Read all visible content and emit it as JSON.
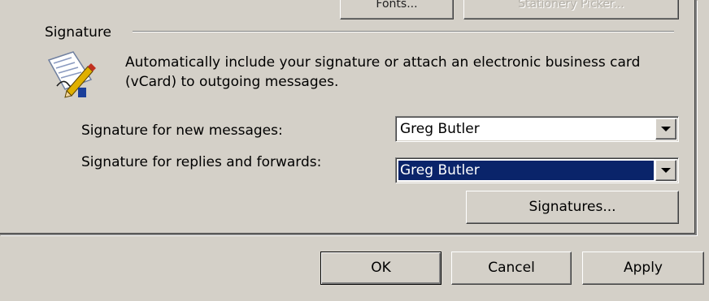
{
  "top_buttons": [
    {
      "label": "Fonts...",
      "disabled": false
    },
    {
      "label": "Stationery Picker...",
      "disabled": true
    }
  ],
  "signature_group": {
    "title": "Signature",
    "icon": "signature-pen-icon",
    "description": "Automatically include your signature or attach an electronic business card (vCard) to outgoing messages.",
    "new_messages_label": "Signature for new messages:",
    "new_messages_value": "Greg Butler",
    "replies_label": "Signature for replies and forwards:",
    "replies_value": "Greg Butler",
    "signatures_button": "Signatures..."
  },
  "dialog_buttons": {
    "ok": "OK",
    "cancel": "Cancel",
    "apply": "Apply"
  },
  "colors": {
    "face": "#d4d0c8",
    "selection": "#0a246a"
  }
}
